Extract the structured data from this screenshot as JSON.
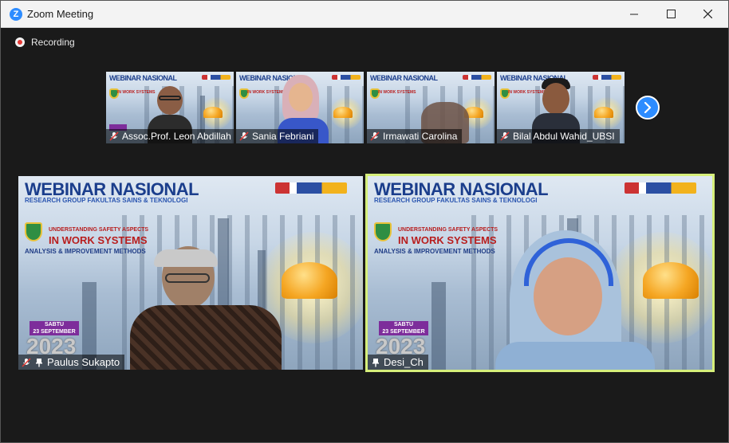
{
  "window": {
    "title": "Zoom Meeting",
    "app_icon_letter": "Z"
  },
  "recording": {
    "label": "Recording"
  },
  "thumbnails": [
    {
      "name": "Assoc.Prof. Leon Abdillah",
      "muted": true
    },
    {
      "name": "Sania Febriani",
      "muted": true
    },
    {
      "name": "Irmawati Carolina",
      "muted": true
    },
    {
      "name": "Bilal Abdul Wahid_UBSI",
      "muted": true
    }
  ],
  "main_tiles": [
    {
      "name": "Paulus Sukapto",
      "muted": true,
      "pinned": true,
      "active": false
    },
    {
      "name": "Desi_Ch",
      "muted": false,
      "pinned": true,
      "active": true
    }
  ],
  "slide": {
    "heading": "WEBINAR NASIONAL",
    "subheading": "RESEARCH GROUP FAKULTAS SAINS & TEKNOLOGI",
    "topic_line1": "UNDERSTANDING SAFETY ASPECTS",
    "topic_line2": "IN WORK SYSTEMS",
    "topic_line3": "ANALYSIS & IMPROVEMENT METHODS",
    "day": "SABTU",
    "date": "23 SEPTEMBER",
    "year": "2023"
  },
  "colors": {
    "accent": "#2d8cff",
    "active_border": "#d6ef7a",
    "recording": "#e53935"
  },
  "icons": {
    "next": "chevron-right-icon",
    "mic": "mic-off-icon",
    "pin": "pin-icon"
  }
}
